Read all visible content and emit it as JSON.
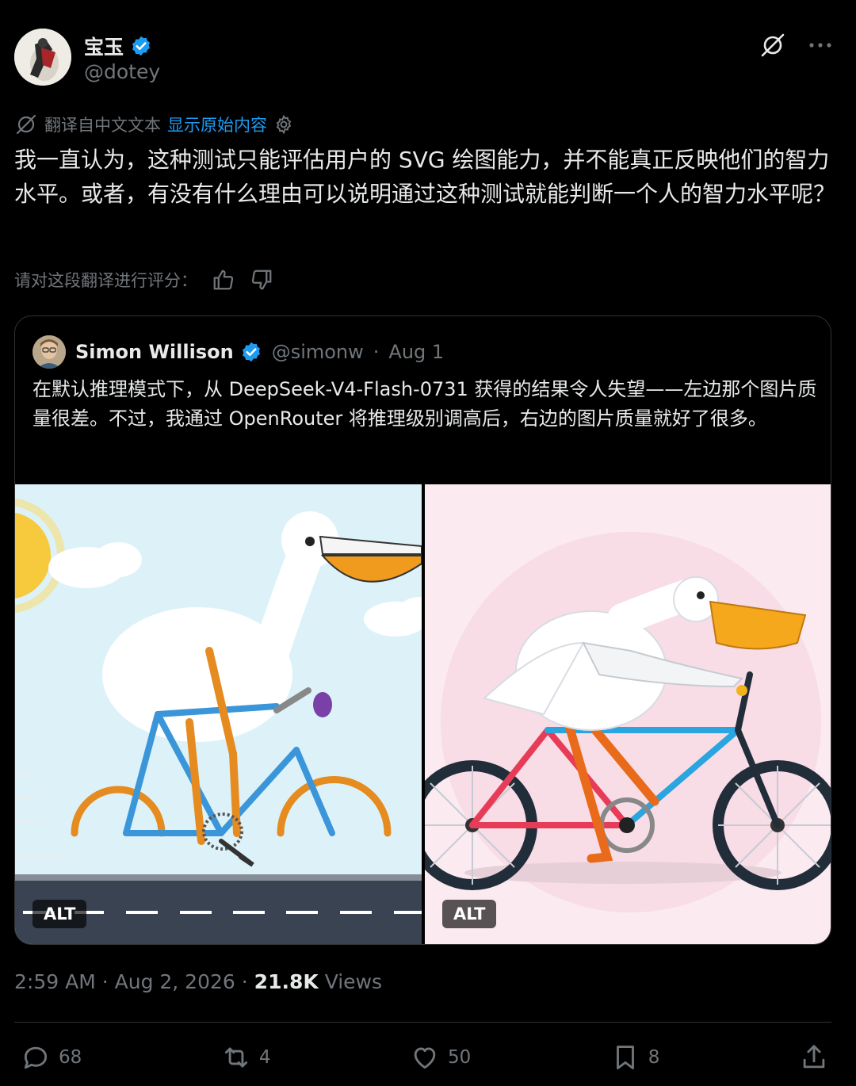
{
  "author": {
    "name": "宝玉",
    "handle": "@dotey"
  },
  "translation": {
    "label": "翻译自中文文本",
    "show_original": "显示原始内容"
  },
  "tweet": {
    "text": "我一直认为，这种测试只能评估用户的 SVG 绘图能力，并不能真正反映他们的智力水平。或者，有没有什么理由可以说明通过这种测试就能判断一个人的智力水平呢？"
  },
  "rating": {
    "label": "请对这段翻译进行评分："
  },
  "quote": {
    "author_name": "Simon Willison",
    "author_handle": "@simonw",
    "separator": "·",
    "date": "Aug 1",
    "text": "在默认推理模式下，从 DeepSeek-V4-Flash-0731 获得的结果令人失望——左边那个图片质量很差。不过，我通过 OpenRouter 将推理级别调高后，右边的图片质量就好了很多。",
    "images": [
      {
        "alt_badge": "ALT"
      },
      {
        "alt_badge": "ALT"
      }
    ]
  },
  "meta": {
    "time": "2:59 AM",
    "separator": "·",
    "date": "Aug 2, 2026",
    "views_count": "21.8K",
    "views_label": "Views"
  },
  "actions": {
    "replies": "68",
    "reposts": "4",
    "likes": "50",
    "bookmarks": "8"
  },
  "icons": {
    "verified": "verified-badge-icon",
    "grok": "grok-icon",
    "more": "more-icon",
    "translate": "translate-icon",
    "settings": "gear-icon",
    "thumb_up": "thumbs-up-icon",
    "thumb_down": "thumbs-down-icon",
    "reply": "reply-icon",
    "repost": "repost-icon",
    "like": "heart-icon",
    "bookmark": "bookmark-icon",
    "share": "share-icon"
  },
  "colors": {
    "background": "#000000",
    "text": "#e7e9ea",
    "muted": "#71767b",
    "link": "#1d9bf0",
    "border": "#2f3336"
  }
}
